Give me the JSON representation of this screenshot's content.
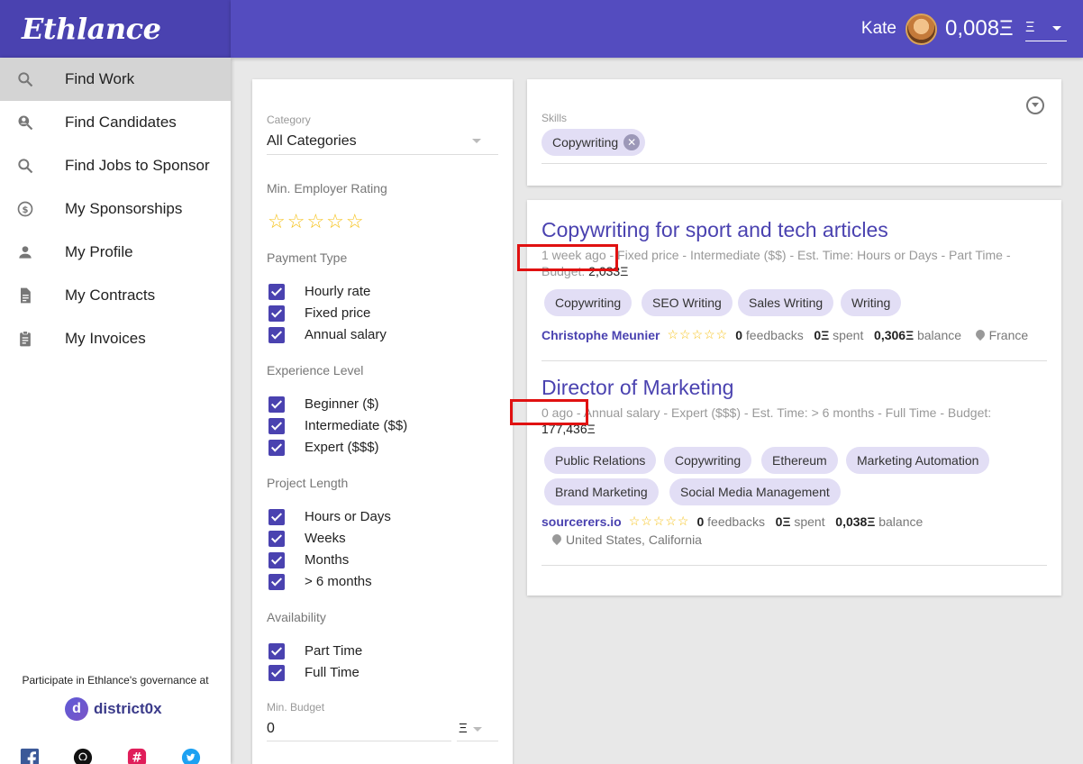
{
  "app": {
    "logo": "Ethlance"
  },
  "topbar": {
    "user_name": "Kate",
    "balance": "0,008Ξ",
    "currency": "Ξ"
  },
  "sidebar": {
    "items": [
      {
        "label": "Find Work",
        "icon": "search-icon",
        "active": true
      },
      {
        "label": "Find Candidates",
        "icon": "person-search-icon"
      },
      {
        "label": "Find Jobs to Sponsor",
        "icon": "search-icon"
      },
      {
        "label": "My Sponsorships",
        "icon": "dollar-circle-icon"
      },
      {
        "label": "My Profile",
        "icon": "person-icon"
      },
      {
        "label": "My Contracts",
        "icon": "document-icon"
      },
      {
        "label": "My Invoices",
        "icon": "clipboard-icon"
      }
    ],
    "governance_text": "Participate in Ethlance's governance at",
    "district_label": "district0x",
    "district_logo_letter": "d",
    "social": [
      "facebook-icon",
      "github-icon",
      "slack-icon",
      "twitter-icon"
    ]
  },
  "filters": {
    "category_label": "Category",
    "category_value": "All Categories",
    "min_rating_label": "Min. Employer Rating",
    "payment_type": {
      "title": "Payment Type",
      "options": [
        "Hourly rate",
        "Fixed price",
        "Annual salary"
      ]
    },
    "experience": {
      "title": "Experience Level",
      "options": [
        "Beginner ($)",
        "Intermediate ($$)",
        "Expert ($$$)"
      ]
    },
    "project_length": {
      "title": "Project Length",
      "options": [
        "Hours or Days",
        "Weeks",
        "Months",
        "> 6 months"
      ]
    },
    "availability": {
      "title": "Availability",
      "options": [
        "Part Time",
        "Full Time"
      ]
    },
    "min_budget_label": "Min. Budget",
    "min_budget_value": "0",
    "min_budget_currency": "Ξ"
  },
  "skills": {
    "label": "Skills",
    "selected": "Copywriting"
  },
  "jobs": [
    {
      "title": "Copywriting for sport and tech articles",
      "meta": "1 week ago - Fixed price - Intermediate ($$) - Est. Time: Hours or Days - Part Time - Budget: ",
      "budget": "2,033Ξ",
      "tags": [
        "Copywriting",
        "SEO Writing",
        "Sales Writing",
        "Writing"
      ],
      "employer": "Christophe Meunier",
      "feedbacks_count": "0",
      "feedbacks_label": "feedbacks",
      "spent_amount": "0Ξ",
      "spent_label": "spent",
      "balance_amount": "0,306Ξ",
      "balance_label": "balance",
      "location": "France"
    },
    {
      "title": "Director of Marketing",
      "meta": "0 ago - Annual salary - Expert ($$$) - Est. Time: > 6 months - Full Time - Budget: ",
      "budget": "177,436Ξ",
      "tags": [
        "Public Relations",
        "Copywriting",
        "Ethereum",
        "Marketing Automation",
        "Brand Marketing",
        "Social Media Management"
      ],
      "employer": "sourcerers.io",
      "feedbacks_count": "0",
      "feedbacks_label": "feedbacks",
      "spent_amount": "0Ξ",
      "spent_label": "spent",
      "balance_amount": "0,038Ξ",
      "balance_label": "balance",
      "location": "United States, California"
    }
  ],
  "stars": "☆☆☆☆☆",
  "highlight_color": "#e01111"
}
